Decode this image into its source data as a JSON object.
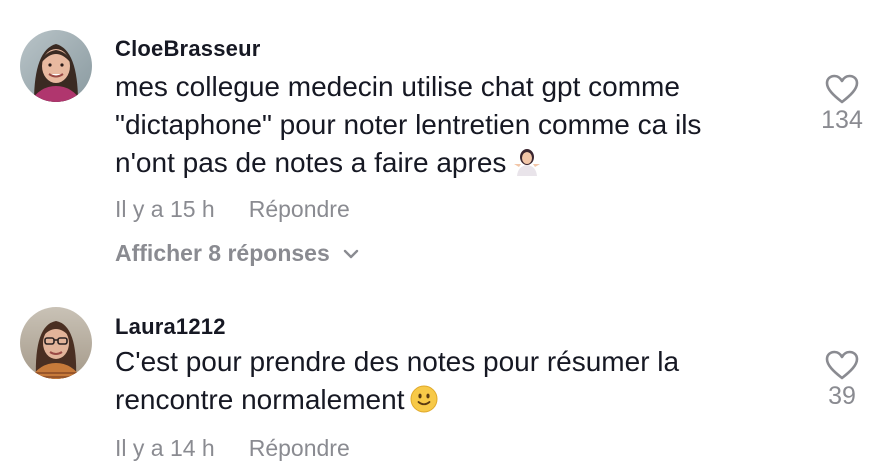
{
  "comments": [
    {
      "username": "CloeBrasseur",
      "text_lines": [
        "mes collegue medecin utilise chat gpt comme",
        "\"dictaphone\" pour noter lentretien comme ca ils",
        "n'ont pas de notes a faire apres"
      ],
      "emoji": "person-shrugging-emoji",
      "time": "Il y a 15 h",
      "reply_label": "Répondre",
      "likes": "134",
      "view_replies": "Afficher 8 réponses"
    },
    {
      "username": "Laura1212",
      "text_lines": [
        "C'est pour prendre des notes pour résumer la",
        "rencontre normalement"
      ],
      "emoji": "slightly-smiling-face-emoji",
      "time": "Il y a 14 h",
      "reply_label": "Répondre",
      "likes": "39"
    }
  ],
  "colors": {
    "text": "#161823",
    "muted": "#8a8b91",
    "background": "#ffffff"
  },
  "icons": {
    "like": "heart-outline-icon",
    "expand": "chevron-down-icon"
  }
}
